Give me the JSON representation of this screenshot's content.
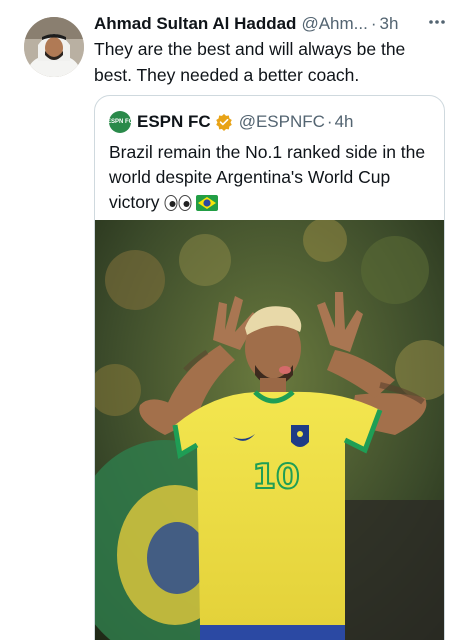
{
  "tweet": {
    "display_name": "Ahmad Sultan Al Haddad",
    "handle": "@Ahm...",
    "separator": "·",
    "time": "3h",
    "more_icon": "more-horizontal-icon",
    "text": "They are the best and will always be the best. They needed a better coach."
  },
  "quote": {
    "logo_text": "ESPN FC",
    "display_name": "ESPN FC",
    "verified_icon": "verified-badge-icon",
    "verified_color": "#e8a317",
    "handle": "@ESPNFC",
    "separator": "·",
    "time": "4h",
    "text": "Brazil remain the No.1 ranked side in the world despite Argentina's World Cup victory",
    "emoji": [
      "eyes-emoji",
      "brazil-flag-emoji"
    ],
    "jersey_number": "10"
  },
  "colors": {
    "text_primary": "#0f1419",
    "text_secondary": "#536471",
    "border": "#cfd9de",
    "jersey_yellow": "#f2e34b",
    "jersey_green": "#1f9e55"
  }
}
